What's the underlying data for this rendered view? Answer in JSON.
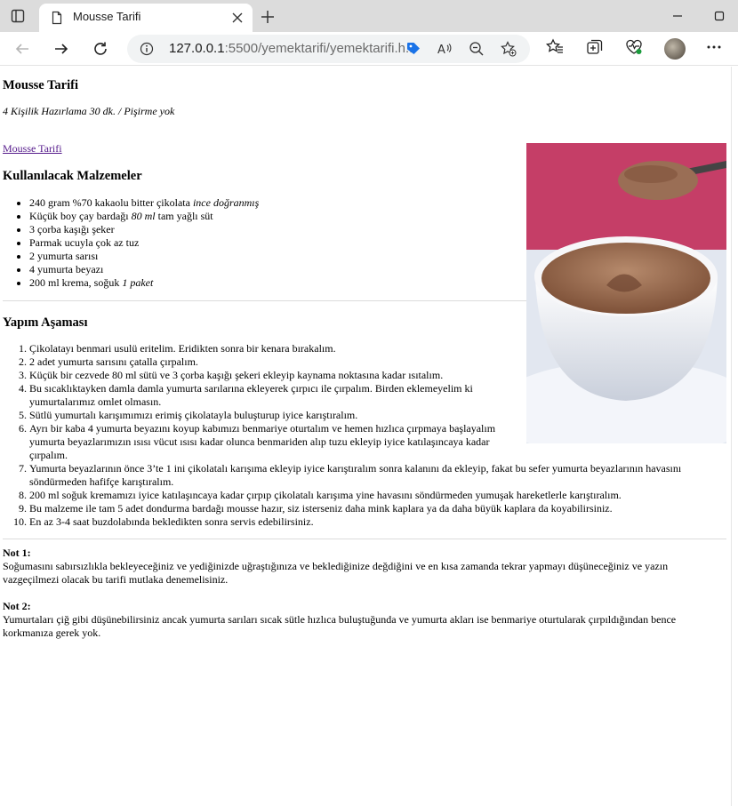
{
  "browser": {
    "tab_title": "Mousse Tarifi",
    "url_host": "127.0.0.1",
    "url_path": ":5500/yemektarifi/yemektarifi.h..."
  },
  "page": {
    "title": "Mousse Tarifi",
    "subtitle": "4 Kişilik Hazırlama 30 dk. / Pişirme yok",
    "link": "Mousse Tarifi",
    "ingredients_heading": "Kullanılacak Malzemeler",
    "ingredients": [
      {
        "text": "240 gram %70 kakaolu bitter çikolata ",
        "em": "ince doğranmış"
      },
      {
        "text": "Küçük boy çay bardağı ",
        "em": "80 ml",
        "after": " tam yağlı süt"
      },
      {
        "text": "3 çorba kaşığı şeker"
      },
      {
        "text": "Parmak ucuyla çok az tuz"
      },
      {
        "text": "2 yumurta sarısı"
      },
      {
        "text": "4 yumurta beyazı"
      },
      {
        "text": "200 ml krema, soğuk ",
        "em": "1 paket"
      }
    ],
    "steps_heading": "Yapım Aşaması",
    "steps": [
      "Çikolatayı benmari usulü eritelim. Eridikten sonra bir kenara bırakalım.",
      "2 adet yumurta sarısını çatalla çırpalım.",
      "Küçük bir cezvede 80 ml sütü ve 3 çorba kaşığı şekeri ekleyip kaynama noktasına kadar ısıtalım.",
      "Bu sıcaklıktayken damla damla yumurta sarılarına ekleyerek çırpıcı ile çırpalım. Birden eklemeyelim ki yumurtalarımız omlet olmasın.",
      "Sütlü yumurtalı karışımımızı erimiş çikolatayla buluşturup iyice karıştıralım.",
      "Ayrı bir kaba 4 yumurta beyazını koyup kabımızı benmariye oturtalım ve hemen hızlıca çırpmaya başlayalım yumurta beyazlarımızın ısısı vücut ısısı kadar olunca benmariden alıp tuzu ekleyip iyice katılaşıncaya kadar çırpalım.",
      "Yumurta beyazlarının önce 3’te 1 ini çikolatalı karışıma ekleyip iyice karıştıralım sonra kalanını da ekleyip, fakat bu sefer yumurta beyazlarının havasını söndürmeden hafifçe karıştıralım.",
      "200 ml soğuk kremamızı iyice katılaşıncaya kadar çırpıp çikolatalı karışıma yine havasını söndürmeden yumuşak hareketlerle karıştıralım.",
      "Bu malzeme ile tam 5 adet dondurma bardağı mousse hazır, siz isterseniz daha mink kaplara ya da daha büyük kaplara da koyabilirsiniz.",
      "En az 3-4 saat buzdolabında bekledikten sonra servis edebilirsiniz."
    ],
    "note1_title": "Not 1:",
    "note1_text": "Soğumasını sabırsızlıkla bekleyeceğiniz ve yediğinizde uğraştığınıza ve beklediğinize değdiğini ve en kısa zamanda tekrar yapmayı düşüneceğiniz ve yazın vazgeçilmezi olacak bu tarifi mutlaka denemelisiniz.",
    "note2_title": "Not 2:",
    "note2_text": "Yumurtaları çiğ gibi düşünebilirsiniz ancak yumurta sarıları sıcak sütle hızlıca buluştuğunda ve yumurta akları ise benmariye oturtularak çırpıldığından bence korkmanıza gerek yok."
  }
}
